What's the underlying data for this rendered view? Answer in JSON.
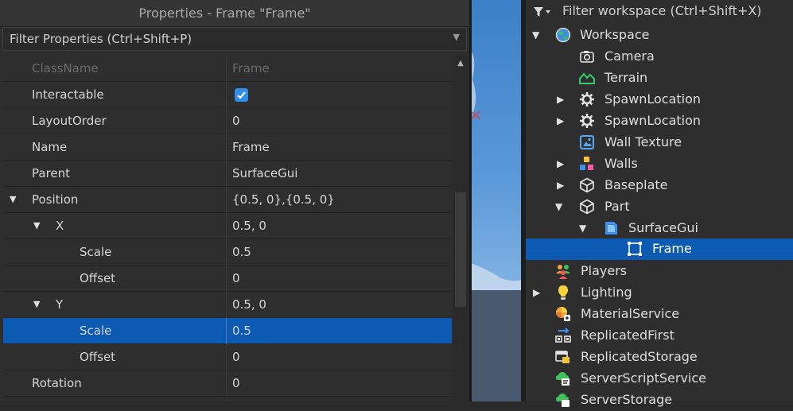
{
  "properties": {
    "title": "Properties - Frame \"Frame\"",
    "close_glyph": "✕",
    "filter_placeholder": "Filter Properties (Ctrl+Shift+P)",
    "rows": [
      {
        "name": "ClassName",
        "value": "Frame"
      },
      {
        "name": "Interactable",
        "value": ""
      },
      {
        "name": "LayoutOrder",
        "value": "0"
      },
      {
        "name": "Name",
        "value": "Frame"
      },
      {
        "name": "Parent",
        "value": "SurfaceGui"
      },
      {
        "name": "Position",
        "value": "{0.5, 0},{0.5, 0}"
      },
      {
        "name": "X",
        "value": "0.5, 0"
      },
      {
        "name": "Scale",
        "value": "0.5"
      },
      {
        "name": "Offset",
        "value": "0"
      },
      {
        "name": "Y",
        "value": "0.5, 0"
      },
      {
        "name": "Scale",
        "value": "0.5"
      },
      {
        "name": "Offset",
        "value": "0"
      },
      {
        "name": "Rotation",
        "value": "0"
      }
    ],
    "interactable_checked": true
  },
  "explorer": {
    "filter_placeholder": "Filter workspace (Ctrl+Shift+X)",
    "items": [
      {
        "label": "Workspace",
        "icon": "workspace-icon"
      },
      {
        "label": "Camera",
        "icon": "camera-icon"
      },
      {
        "label": "Terrain",
        "icon": "terrain-icon"
      },
      {
        "label": "SpawnLocation",
        "icon": "spawn-icon"
      },
      {
        "label": "SpawnLocation",
        "icon": "spawn-icon"
      },
      {
        "label": "Wall Texture",
        "icon": "texture-icon"
      },
      {
        "label": "Walls",
        "icon": "model-icon"
      },
      {
        "label": "Baseplate",
        "icon": "part-icon"
      },
      {
        "label": "Part",
        "icon": "part-icon"
      },
      {
        "label": "SurfaceGui",
        "icon": "surfacegui-icon"
      },
      {
        "label": "Frame",
        "icon": "frame-icon"
      },
      {
        "label": "Players",
        "icon": "players-icon"
      },
      {
        "label": "Lighting",
        "icon": "lighting-icon"
      },
      {
        "label": "MaterialService",
        "icon": "materialservice-icon"
      },
      {
        "label": "ReplicatedFirst",
        "icon": "replicatedfirst-icon"
      },
      {
        "label": "ReplicatedStorage",
        "icon": "replicatedstorage-icon"
      },
      {
        "label": "ServerScriptService",
        "icon": "serverscriptservice-icon"
      },
      {
        "label": "ServerStorage",
        "icon": "serverstorage-icon"
      }
    ]
  },
  "colors": {
    "selection": "#0c5ab2",
    "panel": "#2e2e2e",
    "checkbox": "#2f8ee9"
  }
}
